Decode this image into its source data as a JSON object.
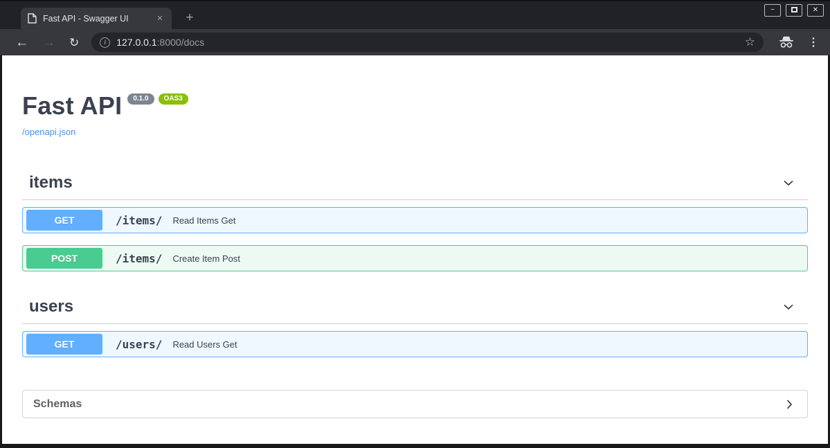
{
  "window": {
    "controls": {
      "minimize_glyph": "−",
      "close_glyph": "✕"
    }
  },
  "browser": {
    "tab_title": "Fast API - Swagger UI",
    "tab_close_glyph": "✕",
    "new_tab_glyph": "+",
    "back_glyph": "←",
    "forward_glyph": "→",
    "reload_glyph": "↻",
    "info_glyph": "i",
    "url_host": "127.0.0.1",
    "url_rest": ":8000/docs",
    "bookmark_glyph": "☆",
    "menu_glyph": "⋮"
  },
  "page": {
    "title": "Fast API",
    "version_badge": "0.1.0",
    "oas_badge": "OAS3",
    "spec_link": "/openapi.json",
    "sections": [
      {
        "name": "items",
        "operations": [
          {
            "method": "GET",
            "path": "/items/",
            "summary": "Read Items Get"
          },
          {
            "method": "POST",
            "path": "/items/",
            "summary": "Create Item Post"
          }
        ]
      },
      {
        "name": "users",
        "operations": [
          {
            "method": "GET",
            "path": "/users/",
            "summary": "Read Users Get"
          }
        ]
      }
    ],
    "schemas_label": "Schemas"
  },
  "colors": {
    "method_get": "#61affe",
    "method_post": "#49cc90",
    "link": "#4990e2",
    "heading_text": "#3b4151",
    "version_badge_bg": "#7d8492",
    "oas_badge_bg": "#89bf04",
    "browser_chrome": "#36383b"
  }
}
